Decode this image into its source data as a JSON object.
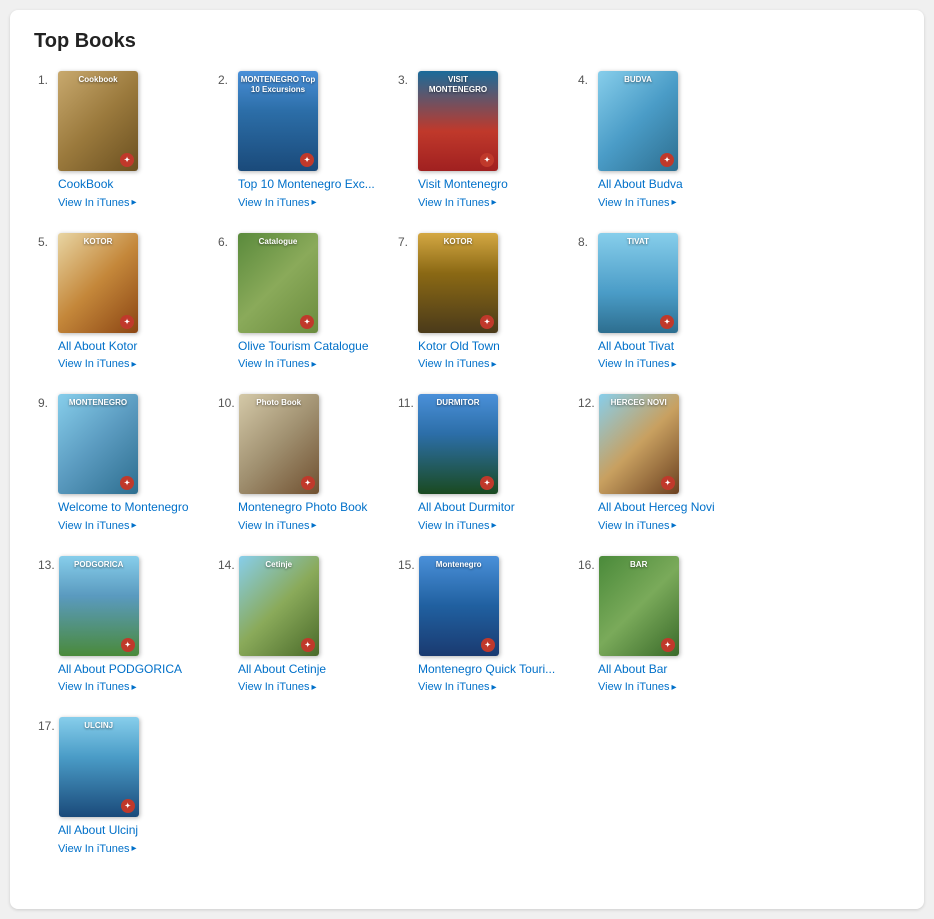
{
  "title": "Top Books",
  "books": [
    {
      "id": 1,
      "number": "1.",
      "title": "CookBook",
      "link": "View In iTunes",
      "coverClass": "cover-cookbook",
      "coverText": "Cookbook"
    },
    {
      "id": 2,
      "number": "2.",
      "title": "Top 10 Montenegro Exc...",
      "link": "View In iTunes",
      "coverClass": "cover-montenegro-top10",
      "coverText": "MONTENEGRO\nTop 10 Excursions"
    },
    {
      "id": 3,
      "number": "3.",
      "title": "Visit Montenegro",
      "link": "View In iTunes",
      "coverClass": "cover-visit-montenegro",
      "coverText": "VISIT MONTENEGRO"
    },
    {
      "id": 4,
      "number": "4.",
      "title": "All About Budva",
      "link": "View In iTunes",
      "coverClass": "cover-budva",
      "coverText": "BUDVA"
    },
    {
      "id": 5,
      "number": "5.",
      "title": "All About Kotor",
      "link": "View In iTunes",
      "coverClass": "cover-kotor",
      "coverText": "KOTOR"
    },
    {
      "id": 6,
      "number": "6.",
      "title": "Olive Tourism Catalogue",
      "link": "View In iTunes",
      "coverClass": "cover-olive",
      "coverText": "Catalogue"
    },
    {
      "id": 7,
      "number": "7.",
      "title": "Kotor Old Town",
      "link": "View In iTunes",
      "coverClass": "cover-kotor-old",
      "coverText": "KOTOR"
    },
    {
      "id": 8,
      "number": "8.",
      "title": "All About Tivat",
      "link": "View In iTunes",
      "coverClass": "cover-tivat",
      "coverText": "TIVAT"
    },
    {
      "id": 9,
      "number": "9.",
      "title": "Welcome to Montenegro",
      "link": "View In iTunes",
      "coverClass": "cover-welcome-montenegro",
      "coverText": "MONTENEGRO"
    },
    {
      "id": 10,
      "number": "10.",
      "title": "Montenegro Photo Book",
      "link": "View In iTunes",
      "coverClass": "cover-photo-book",
      "coverText": "Photo Book"
    },
    {
      "id": 11,
      "number": "11.",
      "title": "All About Durmitor",
      "link": "View In iTunes",
      "coverClass": "cover-durmitor",
      "coverText": "DURMITOR"
    },
    {
      "id": 12,
      "number": "12.",
      "title": "All About Herceg Novi",
      "link": "View In iTunes",
      "coverClass": "cover-herceg-novi",
      "coverText": "HERCEG NOVI"
    },
    {
      "id": 13,
      "number": "13.",
      "title": "All About PODGORICA",
      "link": "View In iTunes",
      "coverClass": "cover-podgorica",
      "coverText": "PODGORICA"
    },
    {
      "id": 14,
      "number": "14.",
      "title": "All About Cetinje",
      "link": "View In iTunes",
      "coverClass": "cover-cetinje",
      "coverText": "Cetinje"
    },
    {
      "id": 15,
      "number": "15.",
      "title": "Montenegro Quick Touri...",
      "link": "View In iTunes",
      "coverClass": "cover-montenegro-quick",
      "coverText": "Montenegro"
    },
    {
      "id": 16,
      "number": "16.",
      "title": "All About Bar",
      "link": "View In iTunes",
      "coverClass": "cover-bar",
      "coverText": "BAR"
    },
    {
      "id": 17,
      "number": "17.",
      "title": "All About Ulcinj",
      "link": "View In iTunes",
      "coverClass": "cover-ulcinj",
      "coverText": "ULCINJ"
    }
  ]
}
